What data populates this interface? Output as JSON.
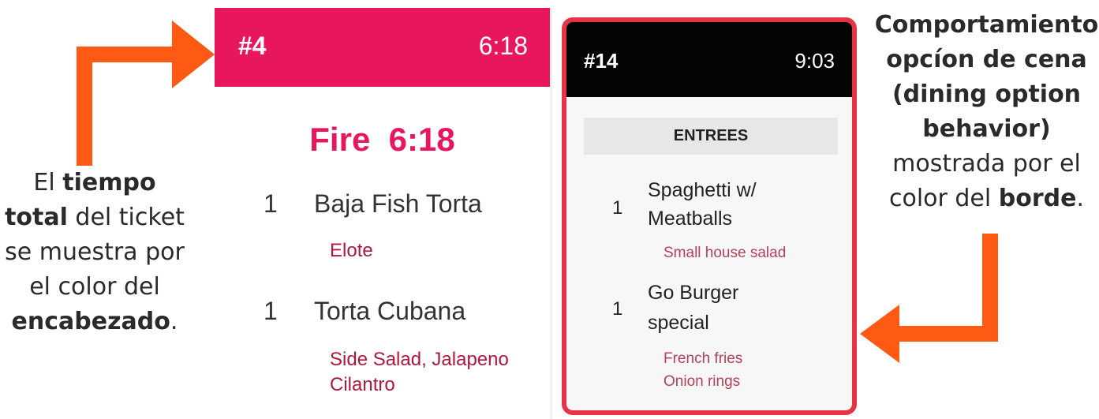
{
  "left_caption": {
    "part1": "El ",
    "bold1": "tiempo total",
    "part2": " del ticket se muestra por el color del ",
    "bold2": "encabezado",
    "part3": "."
  },
  "right_caption": {
    "bold1": "Comportamiento opcíon de cena (dining option behavior)",
    "part1": " mostrada por el color del ",
    "bold2": "borde",
    "part2": "."
  },
  "ticket1": {
    "number": "#4",
    "time": "6:18",
    "header_color": "#e8175d",
    "fire_label": "Fire  6:18",
    "items": [
      {
        "qty": "1",
        "name": "Baja Fish Torta",
        "modifiers": [
          "Elote"
        ]
      },
      {
        "qty": "1",
        "name": "Torta Cubana",
        "modifiers": [
          "Side Salad, Jalapeno",
          "Cilantro"
        ]
      }
    ]
  },
  "ticket2": {
    "number": "#14",
    "time": "9:03",
    "border_color": "#e63345",
    "section": "ENTREES",
    "items": [
      {
        "qty": "1",
        "name_lines": [
          "Spaghetti w/",
          "Meatballs"
        ],
        "modifiers": [
          "Small house salad"
        ]
      },
      {
        "qty": "1",
        "name_lines": [
          "Go Burger",
          "special"
        ],
        "modifiers": [
          "French fries",
          "Onion rings"
        ]
      }
    ]
  },
  "arrow_color": "#ff5a14"
}
